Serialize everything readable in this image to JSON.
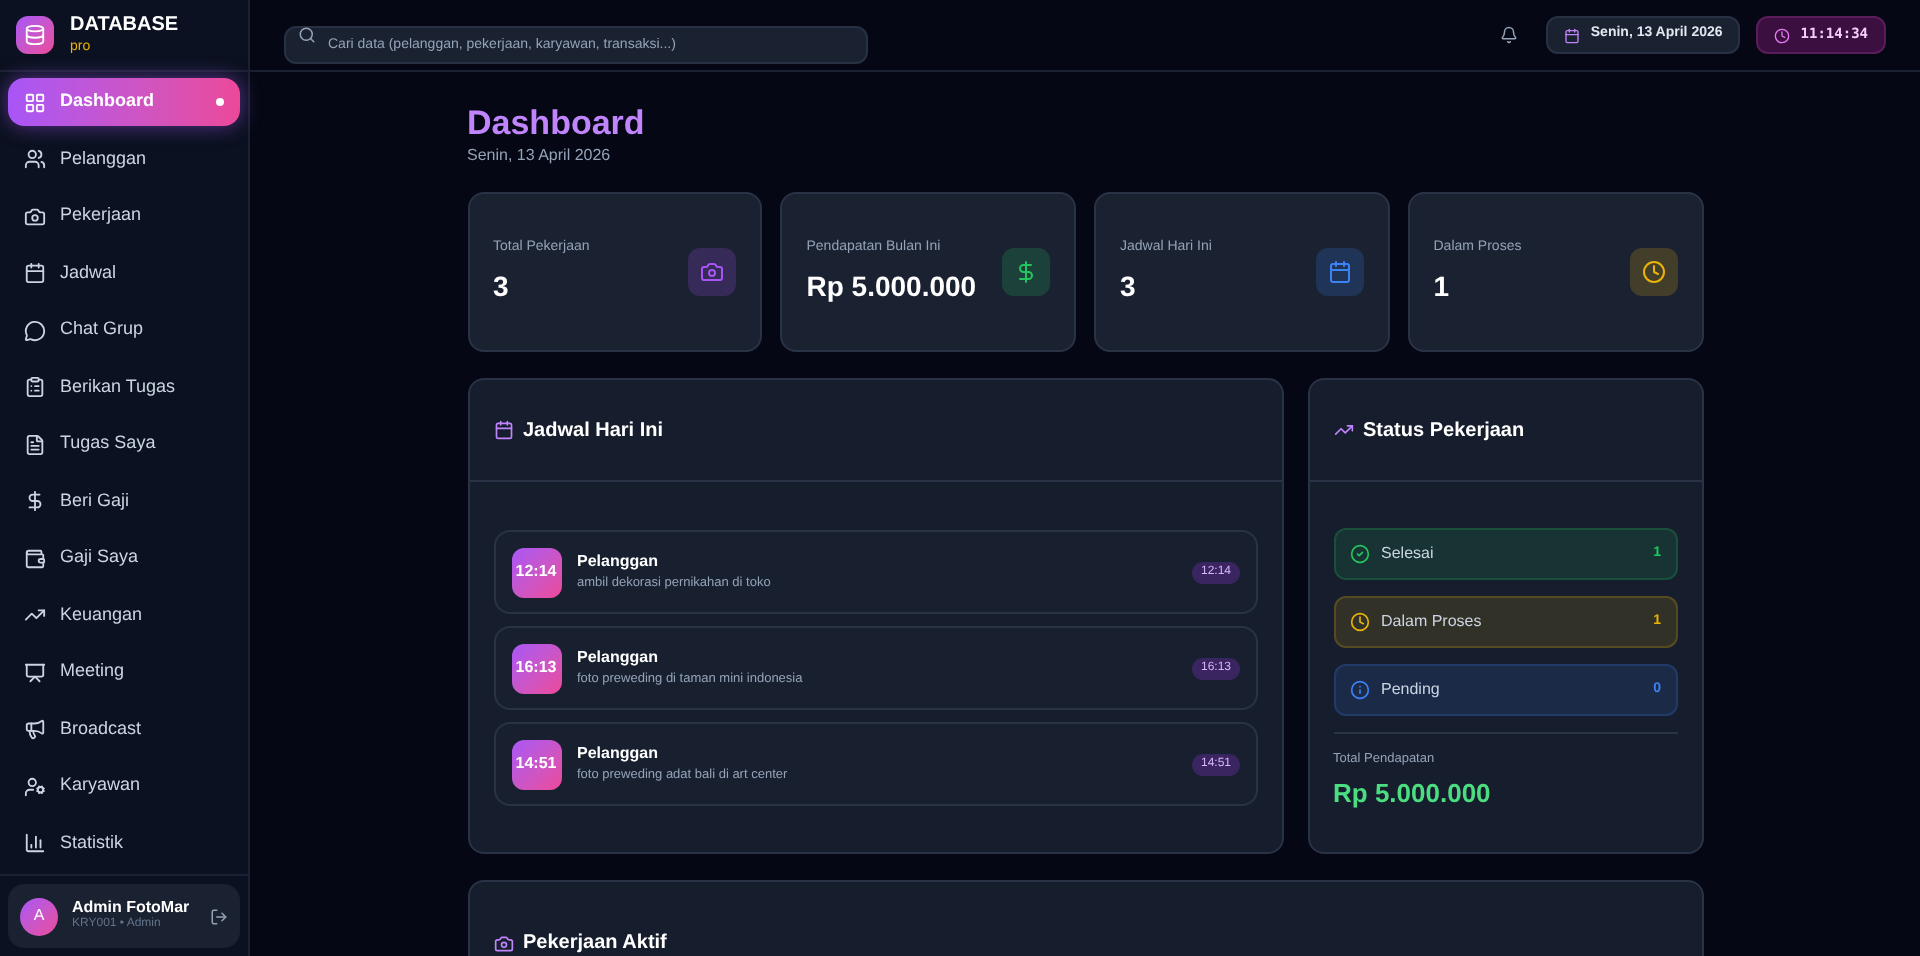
{
  "brand": {
    "title": "DATABASE",
    "subtitle": "pro"
  },
  "sidebar": {
    "items": [
      {
        "label": "Dashboard",
        "selected": true
      },
      {
        "label": "Pelanggan",
        "selected": false
      },
      {
        "label": "Pekerjaan",
        "selected": false
      },
      {
        "label": "Jadwal",
        "selected": false
      },
      {
        "label": "Chat Grup",
        "selected": false
      },
      {
        "label": "Berikan Tugas",
        "selected": false
      },
      {
        "label": "Tugas Saya",
        "selected": false
      },
      {
        "label": "Beri Gaji",
        "selected": false
      },
      {
        "label": "Gaji Saya",
        "selected": false
      },
      {
        "label": "Keuangan",
        "selected": false
      },
      {
        "label": "Meeting",
        "selected": false
      },
      {
        "label": "Broadcast",
        "selected": false
      },
      {
        "label": "Karyawan",
        "selected": false
      },
      {
        "label": "Statistik",
        "selected": false
      }
    ]
  },
  "user": {
    "initial": "A",
    "name": "Admin FotoMar",
    "meta": "KRY001 • Admin"
  },
  "header": {
    "search_placeholder": "Cari data (pelanggan, pekerjaan, karyawan, transaksi...)",
    "date": "Senin, 13 April 2026",
    "time": "11:14:34"
  },
  "page": {
    "title": "Dashboard",
    "subtitle": "Senin, 13 April 2026"
  },
  "stats": [
    {
      "label": "Total Pekerjaan",
      "value": "3",
      "color": "#a855f7"
    },
    {
      "label": "Pendapatan Bulan Ini",
      "value": "Rp 5.000.000",
      "color": "#22c55e"
    },
    {
      "label": "Jadwal Hari Ini",
      "value": "3",
      "color": "#3b82f6"
    },
    {
      "label": "Dalam Proses",
      "value": "1",
      "color": "#eab308"
    }
  ],
  "schedule": {
    "title": "Jadwal Hari Ini",
    "items": [
      {
        "time": "12:14",
        "title": "Pelanggan",
        "desc": "ambil dekorasi pernikahan di toko",
        "badge": "12:14"
      },
      {
        "time": "16:13",
        "title": "Pelanggan",
        "desc": "foto preweding di taman mini indonesia",
        "badge": "16:13"
      },
      {
        "time": "14:51",
        "title": "Pelanggan",
        "desc": "foto preweding adat bali di art center",
        "badge": "14:51"
      }
    ]
  },
  "status": {
    "title": "Status Pekerjaan",
    "items": [
      {
        "label": "Selesai",
        "count": "1",
        "color": "#22c55e"
      },
      {
        "label": "Dalam Proses",
        "count": "1",
        "color": "#eab308"
      },
      {
        "label": "Pending",
        "count": "0",
        "color": "#3b82f6"
      }
    ],
    "total_label": "Total Pendapatan",
    "total_value": "Rp 5.000.000"
  },
  "active_jobs": {
    "title": "Pekerjaan Aktif"
  }
}
